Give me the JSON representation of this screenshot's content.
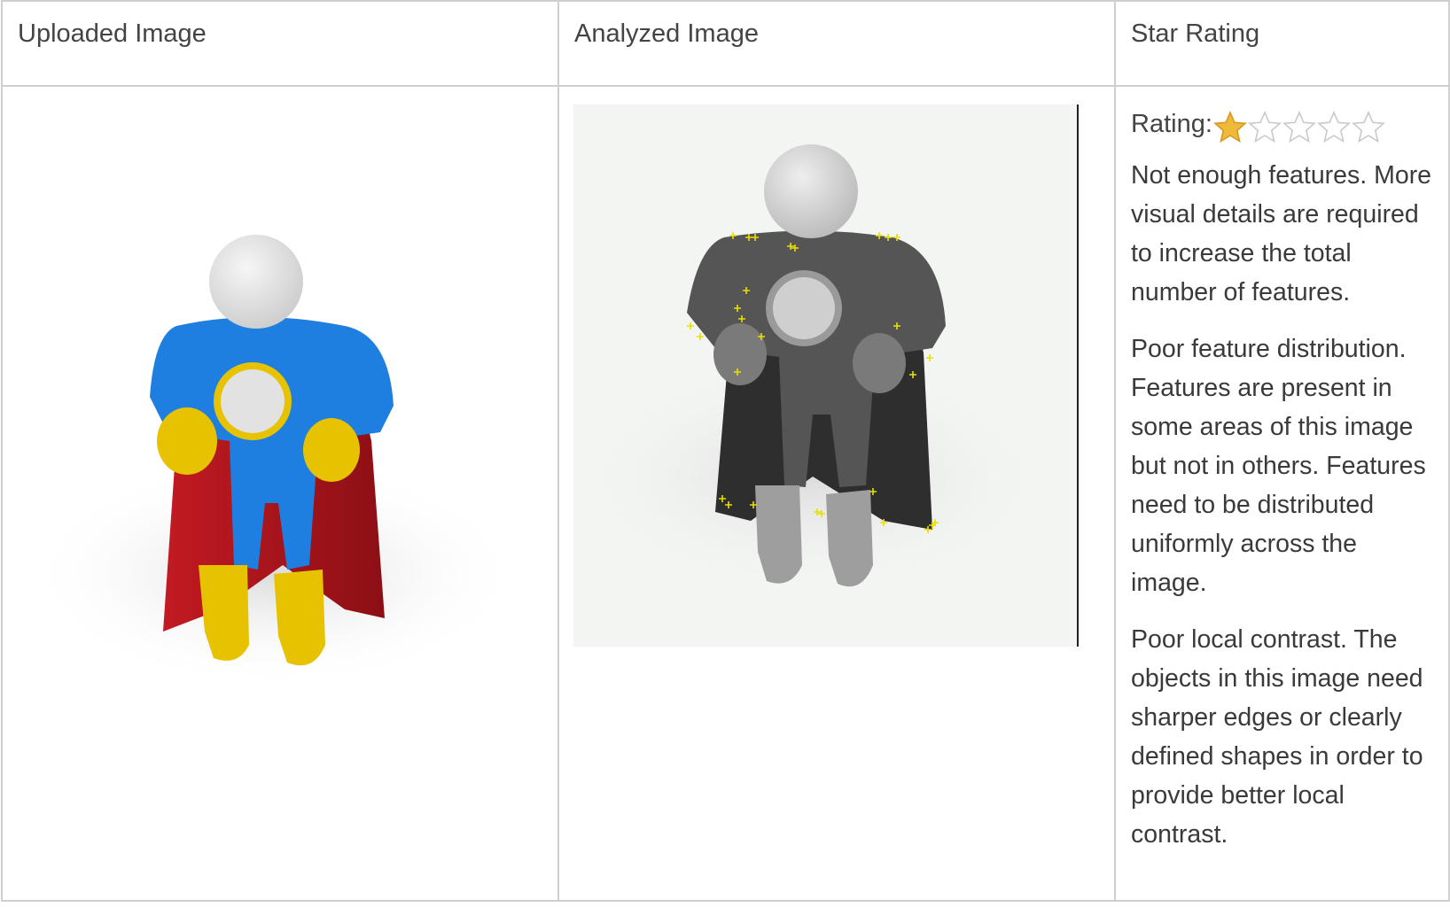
{
  "table": {
    "headers": [
      "Uploaded Image",
      "Analyzed Image",
      "Star Rating"
    ]
  },
  "uploaded_image": {
    "subject": "superhero figure with blue suit, red cape, yellow gloves and boots",
    "colors": {
      "suit": "#1f7fe0",
      "cape": "#b3141c",
      "accent": "#e7c200",
      "head": "#e3e3e3"
    }
  },
  "analyzed_image": {
    "subject": "grayscale superhero figure with yellow feature markers",
    "marker_color": "#e8e000",
    "marker_glyph": "+"
  },
  "rating": {
    "label": "Rating:",
    "score": 1,
    "max": 5,
    "filled_color": "#f0b93a",
    "empty_color": "#c9c9c9",
    "messages": [
      "Not enough features. More visual details are required to increase the total number of features.",
      "Poor feature distribution. Features are present in some areas of this image but not in others. Features need to be distributed uniformly across the image.",
      "Poor local contrast. The objects in this image need sharper edges or clearly defined shapes in order to provide better local contrast."
    ]
  }
}
